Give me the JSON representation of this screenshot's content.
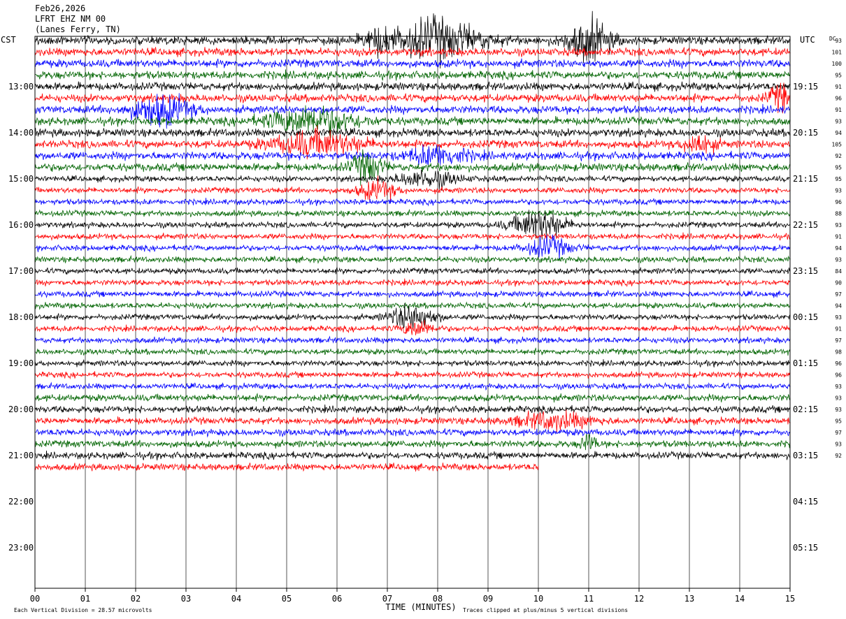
{
  "header": {
    "date": "Feb26,2026",
    "station": "LFRT EHZ NM 00",
    "location": "(Lanes Ferry, TN)"
  },
  "labels": {
    "left_tz": "CST",
    "right_tz": "UTC",
    "dc": "DC",
    "xlabel": "TIME (MINUTES)",
    "footer_left": "Each Vertical Division =   28.57 microvolts",
    "footer_right": "Traces clipped at plus/minus 5 vertical divisions"
  },
  "chart_data": {
    "type": "helicorder",
    "x_ticks": [
      "00",
      "01",
      "02",
      "03",
      "04",
      "05",
      "06",
      "07",
      "08",
      "09",
      "10",
      "11",
      "12",
      "13",
      "14",
      "15"
    ],
    "x_range_minutes": [
      0,
      15
    ],
    "left_time_labels": [
      "13:00",
      "14:00",
      "15:00",
      "16:00",
      "17:00",
      "18:00",
      "19:00",
      "20:00",
      "21:00",
      "22:00",
      "23:00"
    ],
    "right_time_labels": [
      "19:15",
      "20:15",
      "21:15",
      "22:15",
      "23:15",
      "00:15",
      "01:15",
      "02:15",
      "03:15",
      "04:15",
      "05:15"
    ],
    "dc_offsets": [
      93,
      101,
      100,
      95,
      91,
      96,
      91,
      93,
      94,
      105,
      92,
      95,
      95,
      93,
      96,
      88,
      93,
      91,
      94,
      93,
      84,
      90,
      97,
      94,
      93,
      91,
      97,
      98,
      96,
      96,
      93,
      93,
      93,
      95,
      97,
      93,
      92
    ],
    "trace_colors": [
      "#000000",
      "#ff0000",
      "#0000ff",
      "#006400"
    ],
    "trace_count": 38,
    "traces_per_hour": 4,
    "first_trace_time": "12:00",
    "last_trace_partial_minutes": 10,
    "grid": true
  }
}
